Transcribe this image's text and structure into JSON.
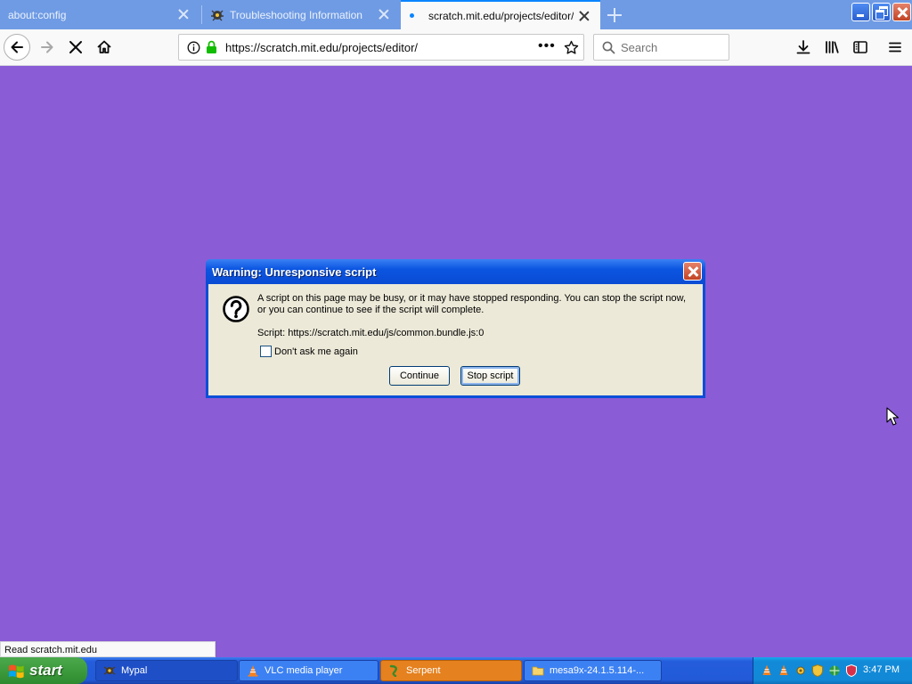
{
  "tabs": [
    {
      "label": "about:config"
    },
    {
      "label": "Troubleshooting Information"
    },
    {
      "label": "scratch.mit.edu/projects/editor/"
    }
  ],
  "navbar": {
    "url": "https://scratch.mit.edu/projects/editor/",
    "search_placeholder": "Search"
  },
  "dialog": {
    "title": "Warning: Unresponsive script",
    "message": "A script on this page may be busy, or it may have stopped responding. You can stop the script now, or you can continue to see if the script will complete.",
    "script": "Script: https://scratch.mit.edu/js/common.bundle.js:0",
    "checkbox_label": "Don't ask me again",
    "continue_label": "Continue",
    "stop_label": "Stop script"
  },
  "status_text": "Read scratch.mit.edu",
  "taskbar": {
    "start_label": "start",
    "tasks": [
      {
        "label": "Mypal"
      },
      {
        "label": "VLC media player"
      },
      {
        "label": "Serpent"
      },
      {
        "label": "mesa9x-24.1.5.114-..."
      }
    ],
    "clock": "3:47 PM"
  },
  "colors": {
    "page_background": "#8a5cd6",
    "tab_strip": "#6f9be4",
    "accent": "#0a84ff",
    "xp_title_blue": "#0b55e1"
  }
}
